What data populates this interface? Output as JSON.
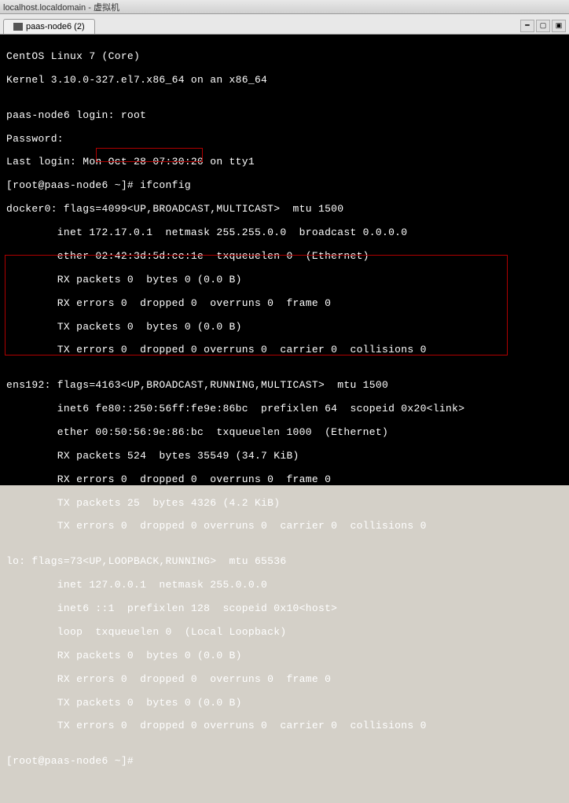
{
  "titlebar": {
    "text": "localhost.localdomain - 虚拟机"
  },
  "tab": {
    "label": "paas-node6 (2)"
  },
  "terminal": {
    "l1": "CentOS Linux 7 (Core)",
    "l2": "Kernel 3.10.0-327.el7.x86_64 on an x86_64",
    "l3": "",
    "l4": "paas-node6 login: root",
    "l5": "Password:",
    "l6": "Last login: Mon Oct 28 07:30:20 on tty1",
    "l7": "[root@paas-node6 ~]# ifconfig",
    "l8": "docker0: flags=4099<UP,BROADCAST,MULTICAST>  mtu 1500",
    "l9": "        inet 172.17.0.1  netmask 255.255.0.0  broadcast 0.0.0.0",
    "l10": "        ether 02:42:3d:5d:cc:1e  txqueuelen 0  (Ethernet)",
    "l11": "        RX packets 0  bytes 0 (0.0 B)",
    "l12": "        RX errors 0  dropped 0  overruns 0  frame 0",
    "l13": "        TX packets 0  bytes 0 (0.0 B)",
    "l14": "        TX errors 0  dropped 0 overruns 0  carrier 0  collisions 0",
    "l15": "",
    "l16": "ens192: flags=4163<UP,BROADCAST,RUNNING,MULTICAST>  mtu 1500",
    "l17": "        inet6 fe80::250:56ff:fe9e:86bc  prefixlen 64  scopeid 0x20<link>",
    "l18": "        ether 00:50:56:9e:86:bc  txqueuelen 1000  (Ethernet)",
    "l19": "        RX packets 524  bytes 35549 (34.7 KiB)",
    "l20": "        RX errors 0  dropped 0  overruns 0  frame 0",
    "l21": "        TX packets 25  bytes 4326 (4.2 KiB)",
    "l22": "        TX errors 0  dropped 0 overruns 0  carrier 0  collisions 0",
    "l23": "",
    "l24": "lo: flags=73<UP,LOOPBACK,RUNNING>  mtu 65536",
    "l25": "        inet 127.0.0.1  netmask 255.0.0.0",
    "l26": "        inet6 ::1  prefixlen 128  scopeid 0x10<host>",
    "l27": "        loop  txqueuelen 0  (Local Loopback)",
    "l28": "        RX packets 0  bytes 0 (0.0 B)",
    "l29": "        RX errors 0  dropped 0  overruns 0  frame 0",
    "l30": "        TX packets 0  bytes 0 (0.0 B)",
    "l31": "        TX errors 0  dropped 0 overruns 0  carrier 0  collisions 0",
    "l32": "",
    "l33": "[root@paas-node6 ~]#"
  }
}
